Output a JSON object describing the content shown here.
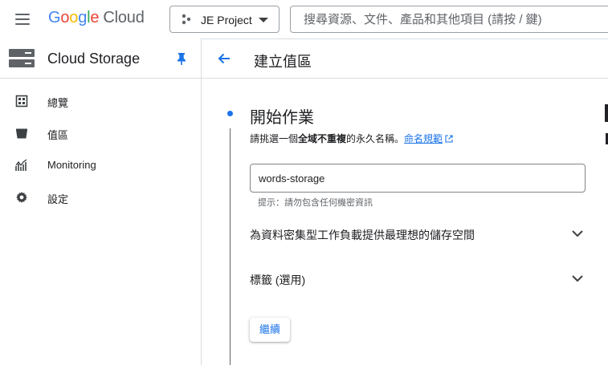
{
  "topbar": {
    "logo_word": "Google",
    "logo_product": "Cloud",
    "project_name": "JE Project",
    "search_placeholder": "搜尋資源、文件、產品和其他項目 (請按 / 鍵)"
  },
  "sidebar": {
    "product_title": "Cloud Storage",
    "items": [
      {
        "label": "總覽",
        "icon": "overview-icon"
      },
      {
        "label": "值區",
        "icon": "bucket-icon"
      },
      {
        "label": "Monitoring",
        "icon": "monitoring-icon"
      },
      {
        "label": "設定",
        "icon": "settings-gear-icon"
      }
    ]
  },
  "main": {
    "page_title": "建立值區",
    "step": {
      "title": "開始作業",
      "desc_prefix": "請挑選一個",
      "desc_bold": "全域不重複",
      "desc_suffix": "的永久名稱。",
      "desc_link": "命名規範",
      "name_value": "words-storage",
      "hint": "提示：請勿包含任何機密資訊",
      "expanders": [
        {
          "label": "為資料密集型工作負載提供最理想的儲存空間"
        },
        {
          "label": "標籤 (選用)"
        }
      ],
      "continue_label": "繼續"
    }
  },
  "colors": {
    "accent": "#1a73e8",
    "text": "#202124",
    "muted": "#5f6368",
    "border": "#dadce0"
  }
}
